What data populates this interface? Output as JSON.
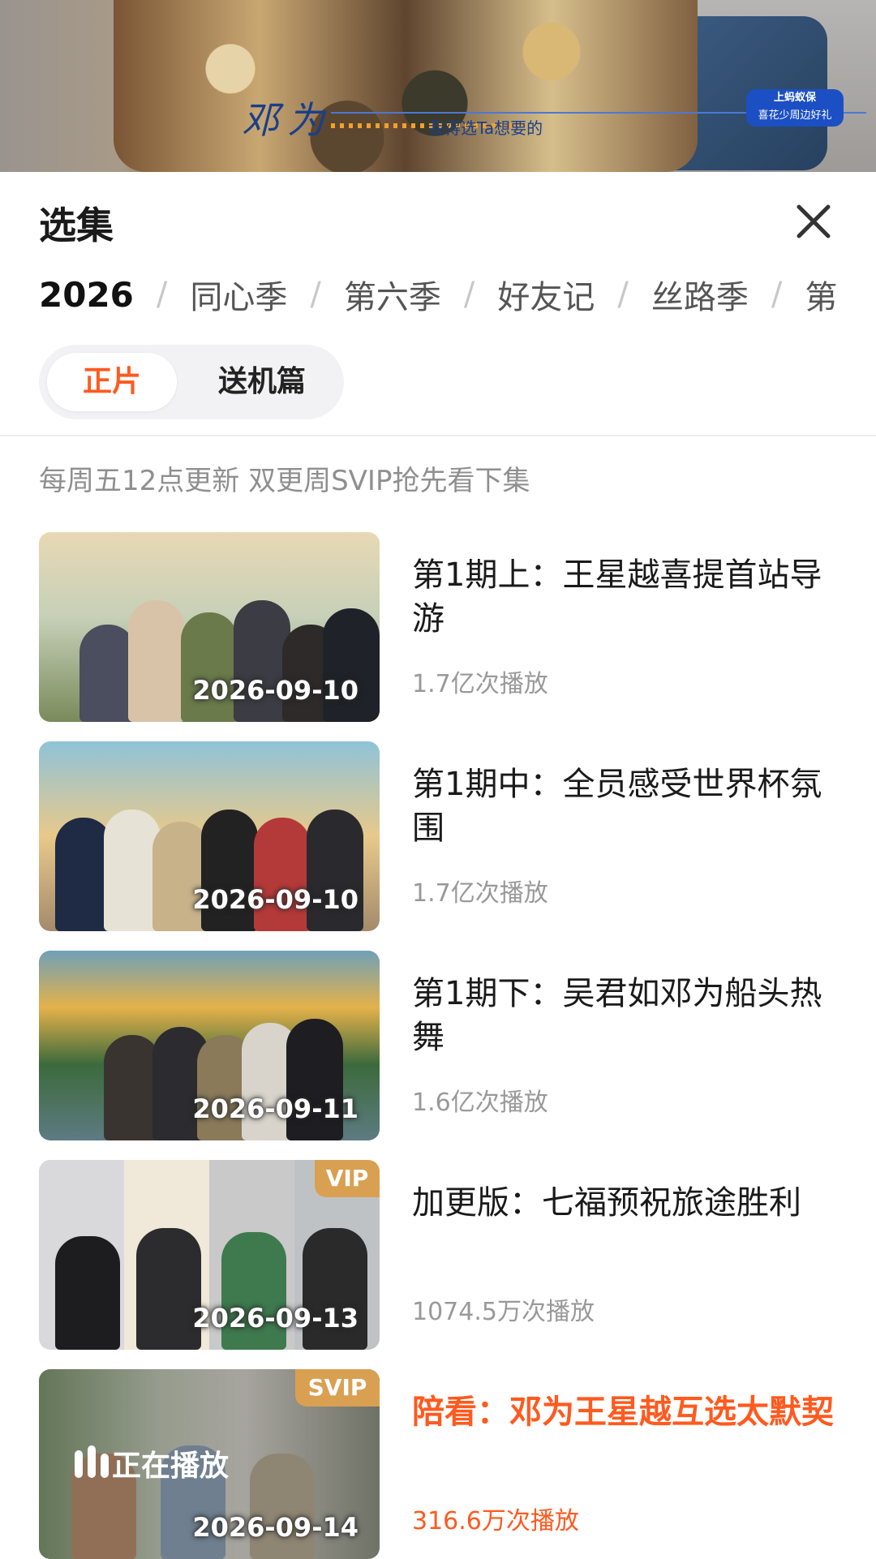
{
  "video": {
    "overlay_name": "邓为",
    "overlay_slogan": "我得选Ta想要的",
    "logo_line1": "上蚂蚁保",
    "logo_line2": "喜花少周边好礼"
  },
  "panel": {
    "title": "选集",
    "close_icon": "close-icon",
    "seasons": [
      "2026",
      "同心季",
      "第六季",
      "好友记",
      "丝路季",
      "第"
    ],
    "active_season_index": 0,
    "segments": [
      "正片",
      "送机篇"
    ],
    "active_segment_index": 0,
    "notice": "每周五12点更新 双更周SVIP抢先看下集"
  },
  "episodes": [
    {
      "title": "第1期上：王星越喜提首站导游",
      "plays": "1.7亿次播放",
      "date": "2026-09-10",
      "badge": "",
      "playing": false
    },
    {
      "title": "第1期中：全员感受世界杯氛围",
      "plays": "1.7亿次播放",
      "date": "2026-09-10",
      "badge": "",
      "playing": false
    },
    {
      "title": "第1期下：吴君如邓为船头热舞",
      "plays": "1.6亿次播放",
      "date": "2026-09-11",
      "badge": "",
      "playing": false
    },
    {
      "title": "加更版：七福预祝旅途胜利",
      "plays": "1074.5万次播放",
      "date": "2026-09-13",
      "badge": "VIP",
      "playing": false
    },
    {
      "title": "陪看：邓为王星越互选太默契",
      "plays": "316.6万次播放",
      "date": "2026-09-14",
      "badge": "SVIP",
      "playing": true,
      "playing_label": "正在播放"
    }
  ],
  "colors": {
    "accent": "#ff5a1f",
    "vip_badge": "#d9a052"
  }
}
